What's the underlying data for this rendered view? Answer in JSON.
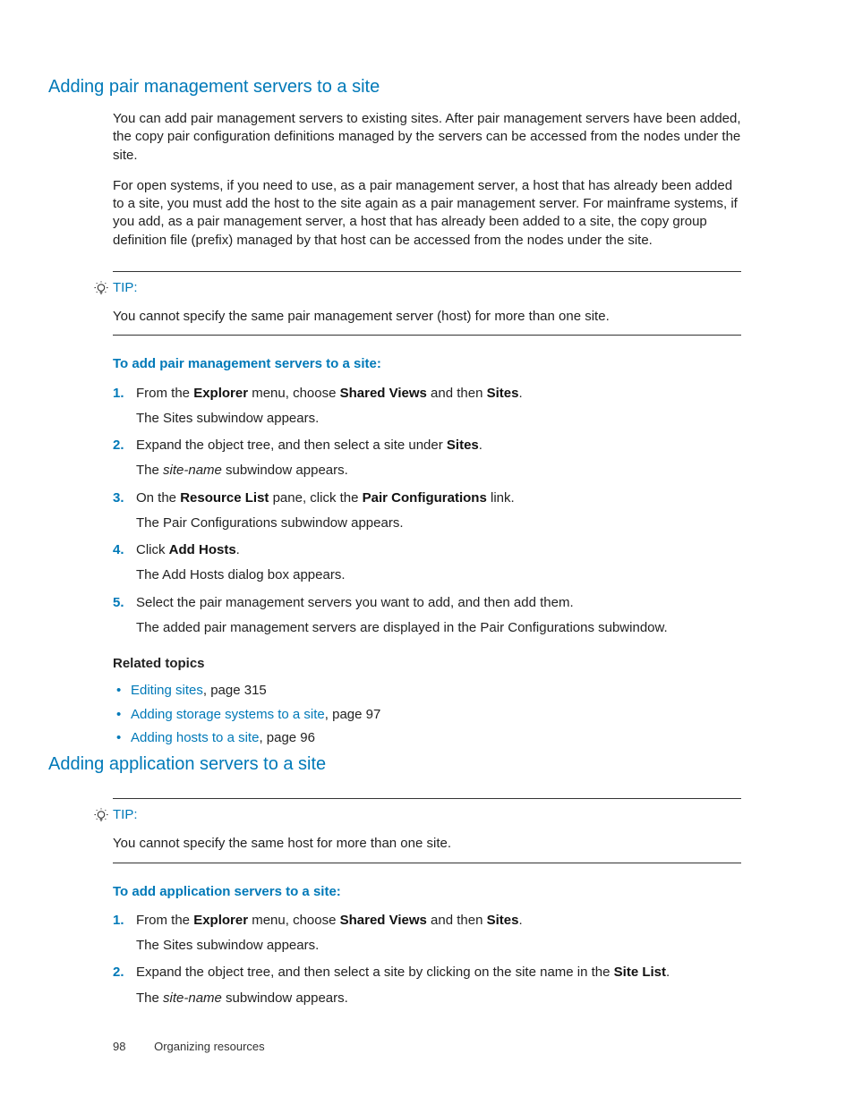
{
  "section1": {
    "heading": "Adding pair management servers to a site",
    "para1": "You can add pair management servers to existing sites. After pair management servers have been added, the copy pair configuration definitions managed by the servers can be accessed from the nodes under the site.",
    "para2": "For open systems, if you need to use, as a pair management server, a host that has already been added to a site, you must add the host to the site again as a pair management server. For mainframe systems, if you add, as a pair management server, a host that has already been added to a site, the copy group definition file (prefix) managed by that host can be accessed from the nodes under the site.",
    "tip_label": "TIP:",
    "tip_text": "You cannot specify the same pair management server (host) for more than one site.",
    "proc_heading": "To add pair management servers to a site:",
    "steps": [
      {
        "n": "1.",
        "pre1": "From the ",
        "bold1": "Explorer",
        "mid1": " menu, choose ",
        "bold2": "Shared Views",
        "mid2": " and then ",
        "bold3": "Sites",
        "post": ".",
        "sub": "The Sites subwindow appears."
      },
      {
        "n": "2.",
        "pre1": "Expand the object tree, and then select a site under ",
        "bold1": "Sites",
        "post": ".",
        "sub_pre": "The ",
        "sub_ital": "site-name",
        "sub_post": " subwindow appears."
      },
      {
        "n": "3.",
        "pre1": "On the ",
        "bold1": "Resource List",
        "mid1": " pane, click the ",
        "bold2": "Pair Configurations",
        "post": " link.",
        "sub": "The Pair Configurations subwindow appears."
      },
      {
        "n": "4.",
        "pre1": "Click ",
        "bold1": "Add Hosts",
        "post": ".",
        "sub": "The Add Hosts dialog box appears."
      },
      {
        "n": "5.",
        "text": "Select the pair management servers you want to add, and then add them.",
        "sub": "The added pair management servers are displayed in the Pair Configurations subwindow."
      }
    ],
    "related_heading": "Related topics",
    "related": [
      {
        "link": "Editing sites",
        "rest": ", page 315"
      },
      {
        "link": "Adding storage systems to a site",
        "rest": ", page 97"
      },
      {
        "link": "Adding hosts to a site",
        "rest": ", page 96"
      }
    ]
  },
  "section2": {
    "heading": "Adding application servers to a site",
    "tip_label": "TIP:",
    "tip_text": "You cannot specify the same host for more than one site.",
    "proc_heading": "To add application servers to a site:",
    "steps": [
      {
        "n": "1.",
        "pre1": "From the ",
        "bold1": "Explorer",
        "mid1": " menu, choose ",
        "bold2": "Shared Views",
        "mid2": " and then ",
        "bold3": "Sites",
        "post": ".",
        "sub": "The Sites subwindow appears."
      },
      {
        "n": "2.",
        "pre1": "Expand the object tree, and then select a site by clicking on the site name in the ",
        "bold1": "Site List",
        "post": ".",
        "sub_pre": "The ",
        "sub_ital": "site-name",
        "sub_post": " subwindow appears."
      }
    ]
  },
  "footer": {
    "page": "98",
    "chapter": "Organizing resources"
  }
}
